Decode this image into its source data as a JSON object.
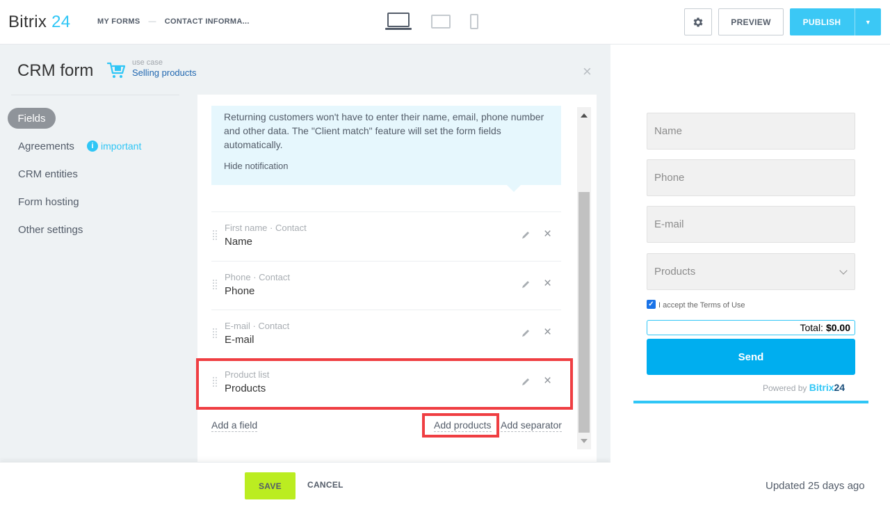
{
  "header": {
    "logo_part1": "Bitrix",
    "logo_part2": "24",
    "breadcrumb": [
      "MY FORMS",
      "CONTACT INFORMA..."
    ],
    "breadcrumb_sep": "—",
    "preview_label": "PREVIEW",
    "publish_label": "PUBLISH",
    "publish_dropdown_glyph": "▼"
  },
  "panel": {
    "title": "CRM form",
    "use_case_label": "use case",
    "use_case_value": "Selling products",
    "close_glyph": "×"
  },
  "nav": {
    "items": [
      "Fields",
      "Agreements",
      "CRM entities",
      "Form hosting",
      "Other settings"
    ],
    "active": "Fields",
    "important_label": "important",
    "important_glyph": "i"
  },
  "notice": {
    "text": "Returning customers won't have to enter their name, email, phone number and other data. The \"Client match\" feature will set the form fields automatically.",
    "hide_label": "Hide notification"
  },
  "fields": [
    {
      "meta": "First name · Contact",
      "name": "Name"
    },
    {
      "meta": "Phone · Contact",
      "name": "Phone"
    },
    {
      "meta": "E-mail · Contact",
      "name": "E-mail"
    },
    {
      "meta": "Product list",
      "name": "Products"
    }
  ],
  "field_actions": {
    "remove_glyph": "×"
  },
  "actions": {
    "add_field": "Add a field",
    "add_products": "Add products",
    "add_separator": "Add separator"
  },
  "footer": {
    "save": "SAVE",
    "cancel": "CANCEL",
    "updated": "Updated 25 days ago"
  },
  "preview": {
    "inputs": [
      "Name",
      "Phone",
      "E-mail"
    ],
    "select": "Products",
    "checkbox_checked": true,
    "check_glyph": "✓",
    "terms": "I accept the Terms of Use",
    "total_label": "Total:",
    "total_value": "$0.00",
    "send": "Send",
    "powered_by": "Powered by",
    "powered_brand1": "Bitrix",
    "powered_brand2": "24"
  },
  "colors": {
    "accent": "#2fc6f6",
    "publish": "#3bc8f5",
    "save": "#bbed21",
    "send": "#00aeef",
    "highlight": "#ef3e42"
  },
  "icons": [
    "gear-icon",
    "laptop-icon",
    "tablet-icon",
    "phone-icon",
    "cart-icon",
    "info-icon",
    "drag-handle-icon",
    "pencil-icon",
    "close-icon",
    "chevron-down-icon",
    "checkbox-icon"
  ]
}
